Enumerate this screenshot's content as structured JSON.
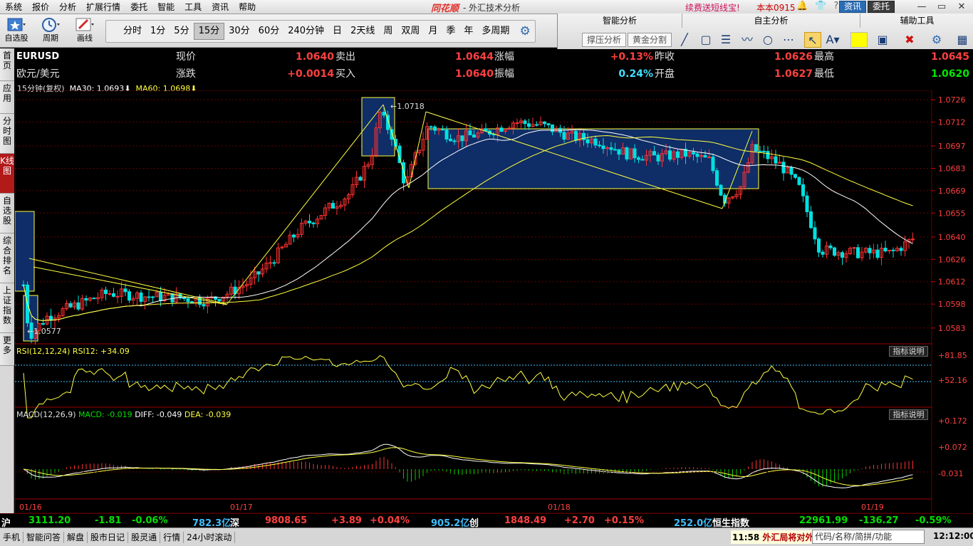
{
  "menu": [
    "系统",
    "报价",
    "分析",
    "扩展行情",
    "委托",
    "智能",
    "工具",
    "资讯",
    "帮助"
  ],
  "brand": {
    "logo": "同花顺",
    "subtitle": "- 外汇技术分析"
  },
  "promo": "续费送短线宝!",
  "version": "本本0915",
  "top_buttons": [
    "资讯",
    "委托"
  ],
  "toolbar_tools": [
    {
      "label": "自选股",
      "icon": "star-icon"
    },
    {
      "label": "周期",
      "icon": "clock-icon"
    },
    {
      "label": "画线",
      "icon": "pencil-icon"
    }
  ],
  "periods": [
    "分时",
    "1分",
    "5分",
    "15分",
    "30分",
    "60分",
    "240分钟",
    "日",
    "2天线",
    "周",
    "双周",
    "月",
    "季",
    "年",
    "多周期"
  ],
  "active_period": "15分",
  "analysis_panel": {
    "headers": [
      "智能分析",
      "自主分析",
      "辅助工具"
    ],
    "buttons": [
      "撑压分析",
      "黄金分割"
    ]
  },
  "vtabs": [
    "首页",
    "应用",
    "分时图",
    "K线图",
    "自选股",
    "综合排名",
    "上证指数",
    "更多"
  ],
  "quote": {
    "symbol": "EURUSD",
    "name": "欧元/美元",
    "labels": [
      "现价",
      "涨跌",
      "卖出",
      "买入",
      "涨幅",
      "振幅",
      "昨收",
      "开盘",
      "最高",
      "最低"
    ],
    "price": "1.0640",
    "change": "+0.0014",
    "ask": "1.0644",
    "bid": "1.0640",
    "pct": "+0.13%",
    "amplitude": "0.24%",
    "prev_close": "1.0626",
    "open": "1.0627",
    "high": "1.0645",
    "low": "1.0620"
  },
  "ma_label": {
    "period": "15分钟(复权)",
    "ma30": "MA30: 1.0693",
    "ma60": "MA60: 1.0698"
  },
  "rsi_label": "RSI(12,12,24)  RSI12: +34.09",
  "macd_label": {
    "head": "MACD(12,26,9)",
    "macd": "MACD: -0.019",
    "diff": "DIFF: -0.049",
    "dea": "DEA: -0.039"
  },
  "indicator_btn": "指标说明",
  "annotations": {
    "high": "1.0718",
    "low": "1.0577"
  },
  "date_labels": [
    "01/16",
    "01/17",
    "01/18",
    "01/19"
  ],
  "status": {
    "sh_label": "沪",
    "sh_val": "3111.20",
    "sh_chg": "-1.81",
    "sh_pct": "-0.06%",
    "sh_amt": "782.3亿",
    "sz_label": "深",
    "sz_val": "9808.65",
    "sz_chg": "+3.89",
    "sz_pct": "+0.04%",
    "sz_amt": "905.2亿",
    "cy_label": "创",
    "cy_val": "1848.49",
    "cy_chg": "+2.70",
    "cy_pct": "+0.15%",
    "cy_amt": "252.0亿",
    "hs_label": "恒生指数",
    "hs_val": "22961.99",
    "hs_chg": "-136.27",
    "hs_pct": "-0.59%"
  },
  "bottom_tabs": [
    "手机",
    "智能问答",
    "解盘",
    "股市日记",
    "股灵通",
    "行情",
    "24小时滚动"
  ],
  "news": {
    "time": "11:58",
    "text": "外汇局将对外"
  },
  "quick_search": "代码/名称/简拼/功能",
  "clock": "12:12:00",
  "colors": {
    "up": "#ff3030",
    "down": "#00e0e0",
    "ma30": "#ffffff",
    "ma60": "#ffff3c",
    "grid": "#6a0000",
    "box": "#0f2d66"
  },
  "chart_data": {
    "type": "candlestick",
    "price_axis": [
      "1.0726",
      "1.0712",
      "1.0697",
      "1.0683",
      "1.0669",
      "1.0655",
      "1.0640",
      "1.0626",
      "1.0612",
      "1.0598",
      "1.0583"
    ],
    "rsi_axis": [
      "+81.85",
      "+52.16"
    ],
    "macd_axis": [
      "+0.172",
      "+0.072",
      "-0.031"
    ],
    "ylim": [
      1.0574,
      1.073
    ]
  }
}
